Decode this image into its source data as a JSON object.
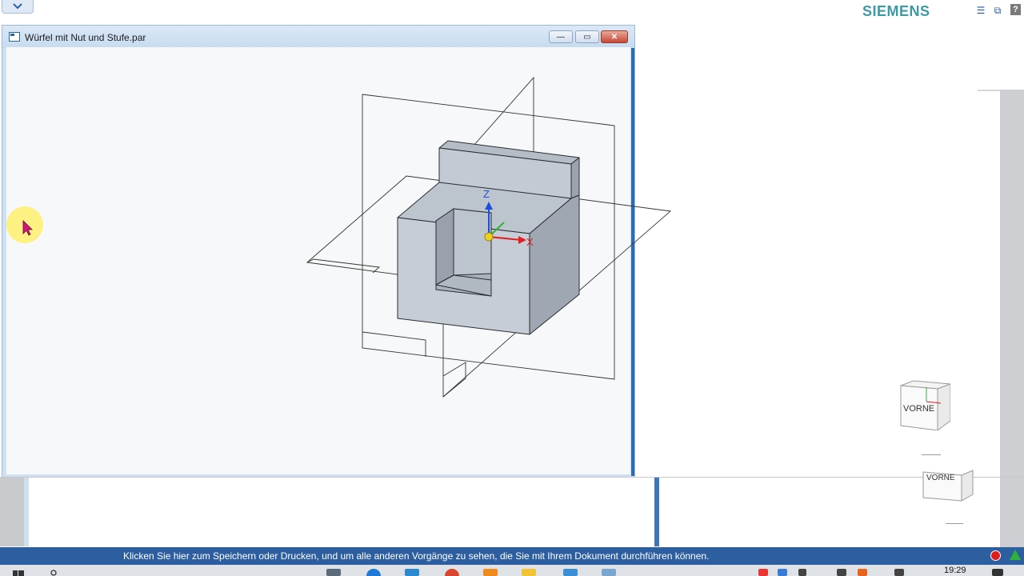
{
  "app": {
    "brand": "SIEMENS",
    "help_label": "?"
  },
  "document": {
    "title": "Würfel mit Nut und Stufe.par",
    "minimize_label": "—",
    "restore_label": "▭",
    "close_label": "✕"
  },
  "triad": {
    "z_label": "Z",
    "x_label": "X"
  },
  "viewcube": {
    "face_label": "VORNE",
    "face_label_2": "VORNE"
  },
  "status": {
    "message": "Klicken Sie hier zum Speichern oder Drucken, und um alle anderen Vorgänge zu sehen, die Sie mit Ihrem Dokument durchführen können."
  },
  "taskbar": {
    "clock": "19:29"
  },
  "colors": {
    "brand": "#3a9aa6",
    "status_bar": "#2d5fa0",
    "record": "#e01b1b",
    "axis_x": "#e02020",
    "axis_y": "#2fb23a",
    "axis_z": "#1f4fd8"
  }
}
